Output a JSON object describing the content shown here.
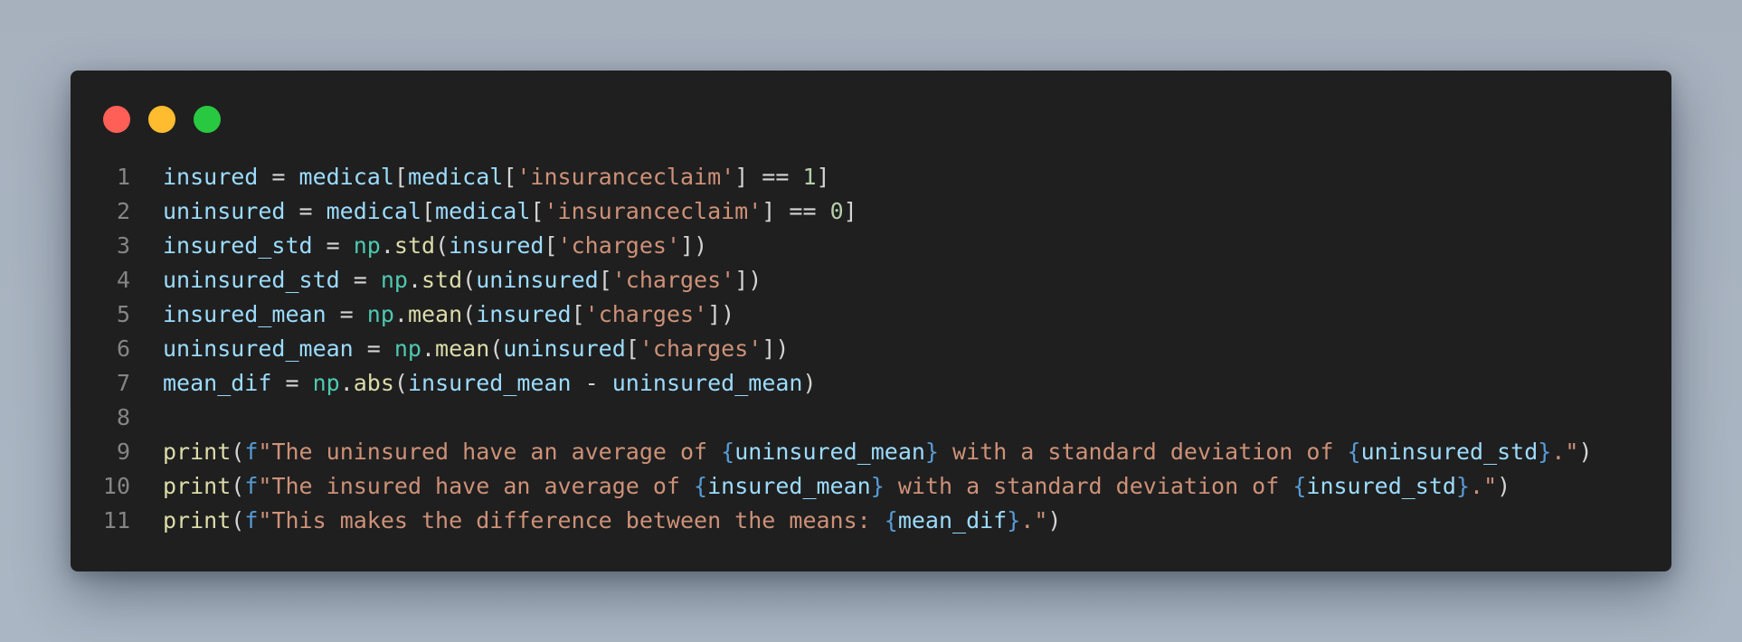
{
  "window": {
    "controls": [
      {
        "name": "close",
        "color": "#ff5f57"
      },
      {
        "name": "minimize",
        "color": "#febc2e"
      },
      {
        "name": "zoom",
        "color": "#28c840"
      }
    ]
  },
  "code": {
    "language": "python",
    "lines": [
      {
        "number": "1",
        "tokens": [
          {
            "t": "insured",
            "k": "var"
          },
          {
            "t": " = ",
            "k": "op"
          },
          {
            "t": "medical",
            "k": "var"
          },
          {
            "t": "[",
            "k": "punc"
          },
          {
            "t": "medical",
            "k": "var"
          },
          {
            "t": "[",
            "k": "punc"
          },
          {
            "t": "'insuranceclaim'",
            "k": "str"
          },
          {
            "t": "] == ",
            "k": "op"
          },
          {
            "t": "1",
            "k": "num"
          },
          {
            "t": "]",
            "k": "punc"
          }
        ]
      },
      {
        "number": "2",
        "tokens": [
          {
            "t": "uninsured",
            "k": "var"
          },
          {
            "t": " = ",
            "k": "op"
          },
          {
            "t": "medical",
            "k": "var"
          },
          {
            "t": "[",
            "k": "punc"
          },
          {
            "t": "medical",
            "k": "var"
          },
          {
            "t": "[",
            "k": "punc"
          },
          {
            "t": "'insuranceclaim'",
            "k": "str"
          },
          {
            "t": "] == ",
            "k": "op"
          },
          {
            "t": "0",
            "k": "num"
          },
          {
            "t": "]",
            "k": "punc"
          }
        ]
      },
      {
        "number": "3",
        "tokens": [
          {
            "t": "insured_std",
            "k": "var"
          },
          {
            "t": " = ",
            "k": "op"
          },
          {
            "t": "np",
            "k": "mod"
          },
          {
            "t": ".",
            "k": "punc"
          },
          {
            "t": "std",
            "k": "fn"
          },
          {
            "t": "(",
            "k": "punc"
          },
          {
            "t": "insured",
            "k": "var"
          },
          {
            "t": "[",
            "k": "punc"
          },
          {
            "t": "'charges'",
            "k": "str"
          },
          {
            "t": "])",
            "k": "punc"
          }
        ]
      },
      {
        "number": "4",
        "tokens": [
          {
            "t": "uninsured_std",
            "k": "var"
          },
          {
            "t": " = ",
            "k": "op"
          },
          {
            "t": "np",
            "k": "mod"
          },
          {
            "t": ".",
            "k": "punc"
          },
          {
            "t": "std",
            "k": "fn"
          },
          {
            "t": "(",
            "k": "punc"
          },
          {
            "t": "uninsured",
            "k": "var"
          },
          {
            "t": "[",
            "k": "punc"
          },
          {
            "t": "'charges'",
            "k": "str"
          },
          {
            "t": "])",
            "k": "punc"
          }
        ]
      },
      {
        "number": "5",
        "tokens": [
          {
            "t": "insured_mean",
            "k": "var"
          },
          {
            "t": " = ",
            "k": "op"
          },
          {
            "t": "np",
            "k": "mod"
          },
          {
            "t": ".",
            "k": "punc"
          },
          {
            "t": "mean",
            "k": "fn"
          },
          {
            "t": "(",
            "k": "punc"
          },
          {
            "t": "insured",
            "k": "var"
          },
          {
            "t": "[",
            "k": "punc"
          },
          {
            "t": "'charges'",
            "k": "str"
          },
          {
            "t": "])",
            "k": "punc"
          }
        ]
      },
      {
        "number": "6",
        "tokens": [
          {
            "t": "uninsured_mean",
            "k": "var"
          },
          {
            "t": " = ",
            "k": "op"
          },
          {
            "t": "np",
            "k": "mod"
          },
          {
            "t": ".",
            "k": "punc"
          },
          {
            "t": "mean",
            "k": "fn"
          },
          {
            "t": "(",
            "k": "punc"
          },
          {
            "t": "uninsured",
            "k": "var"
          },
          {
            "t": "[",
            "k": "punc"
          },
          {
            "t": "'charges'",
            "k": "str"
          },
          {
            "t": "])",
            "k": "punc"
          }
        ]
      },
      {
        "number": "7",
        "tokens": [
          {
            "t": "mean_dif",
            "k": "var"
          },
          {
            "t": " = ",
            "k": "op"
          },
          {
            "t": "np",
            "k": "mod"
          },
          {
            "t": ".",
            "k": "punc"
          },
          {
            "t": "abs",
            "k": "fn"
          },
          {
            "t": "(",
            "k": "punc"
          },
          {
            "t": "insured_mean",
            "k": "var"
          },
          {
            "t": " - ",
            "k": "op"
          },
          {
            "t": "uninsured_mean",
            "k": "var"
          },
          {
            "t": ")",
            "k": "punc"
          }
        ]
      },
      {
        "number": "8",
        "tokens": []
      },
      {
        "number": "9",
        "tokens": [
          {
            "t": "print",
            "k": "fn"
          },
          {
            "t": "(",
            "k": "punc"
          },
          {
            "t": "f",
            "k": "kw"
          },
          {
            "t": "\"The uninsured have an average of ",
            "k": "str"
          },
          {
            "t": "{",
            "k": "brace"
          },
          {
            "t": "uninsured_mean",
            "k": "var"
          },
          {
            "t": "}",
            "k": "brace"
          },
          {
            "t": " with a standard deviation of ",
            "k": "str"
          },
          {
            "t": "{",
            "k": "brace"
          },
          {
            "t": "uninsured_std",
            "k": "var"
          },
          {
            "t": "}",
            "k": "brace"
          },
          {
            "t": ".\"",
            "k": "str"
          },
          {
            "t": ")",
            "k": "punc"
          }
        ]
      },
      {
        "number": "10",
        "tokens": [
          {
            "t": "print",
            "k": "fn"
          },
          {
            "t": "(",
            "k": "punc"
          },
          {
            "t": "f",
            "k": "kw"
          },
          {
            "t": "\"The insured have an average of ",
            "k": "str"
          },
          {
            "t": "{",
            "k": "brace"
          },
          {
            "t": "insured_mean",
            "k": "var"
          },
          {
            "t": "}",
            "k": "brace"
          },
          {
            "t": " with a standard deviation of ",
            "k": "str"
          },
          {
            "t": "{",
            "k": "brace"
          },
          {
            "t": "insured_std",
            "k": "var"
          },
          {
            "t": "}",
            "k": "brace"
          },
          {
            "t": ".\"",
            "k": "str"
          },
          {
            "t": ")",
            "k": "punc"
          }
        ]
      },
      {
        "number": "11",
        "tokens": [
          {
            "t": "print",
            "k": "fn"
          },
          {
            "t": "(",
            "k": "punc"
          },
          {
            "t": "f",
            "k": "kw"
          },
          {
            "t": "\"This makes the difference between the means: ",
            "k": "str"
          },
          {
            "t": "{",
            "k": "brace"
          },
          {
            "t": "mean_dif",
            "k": "var"
          },
          {
            "t": "}",
            "k": "brace"
          },
          {
            "t": ".\"",
            "k": "str"
          },
          {
            "t": ")",
            "k": "punc"
          }
        ]
      }
    ]
  }
}
